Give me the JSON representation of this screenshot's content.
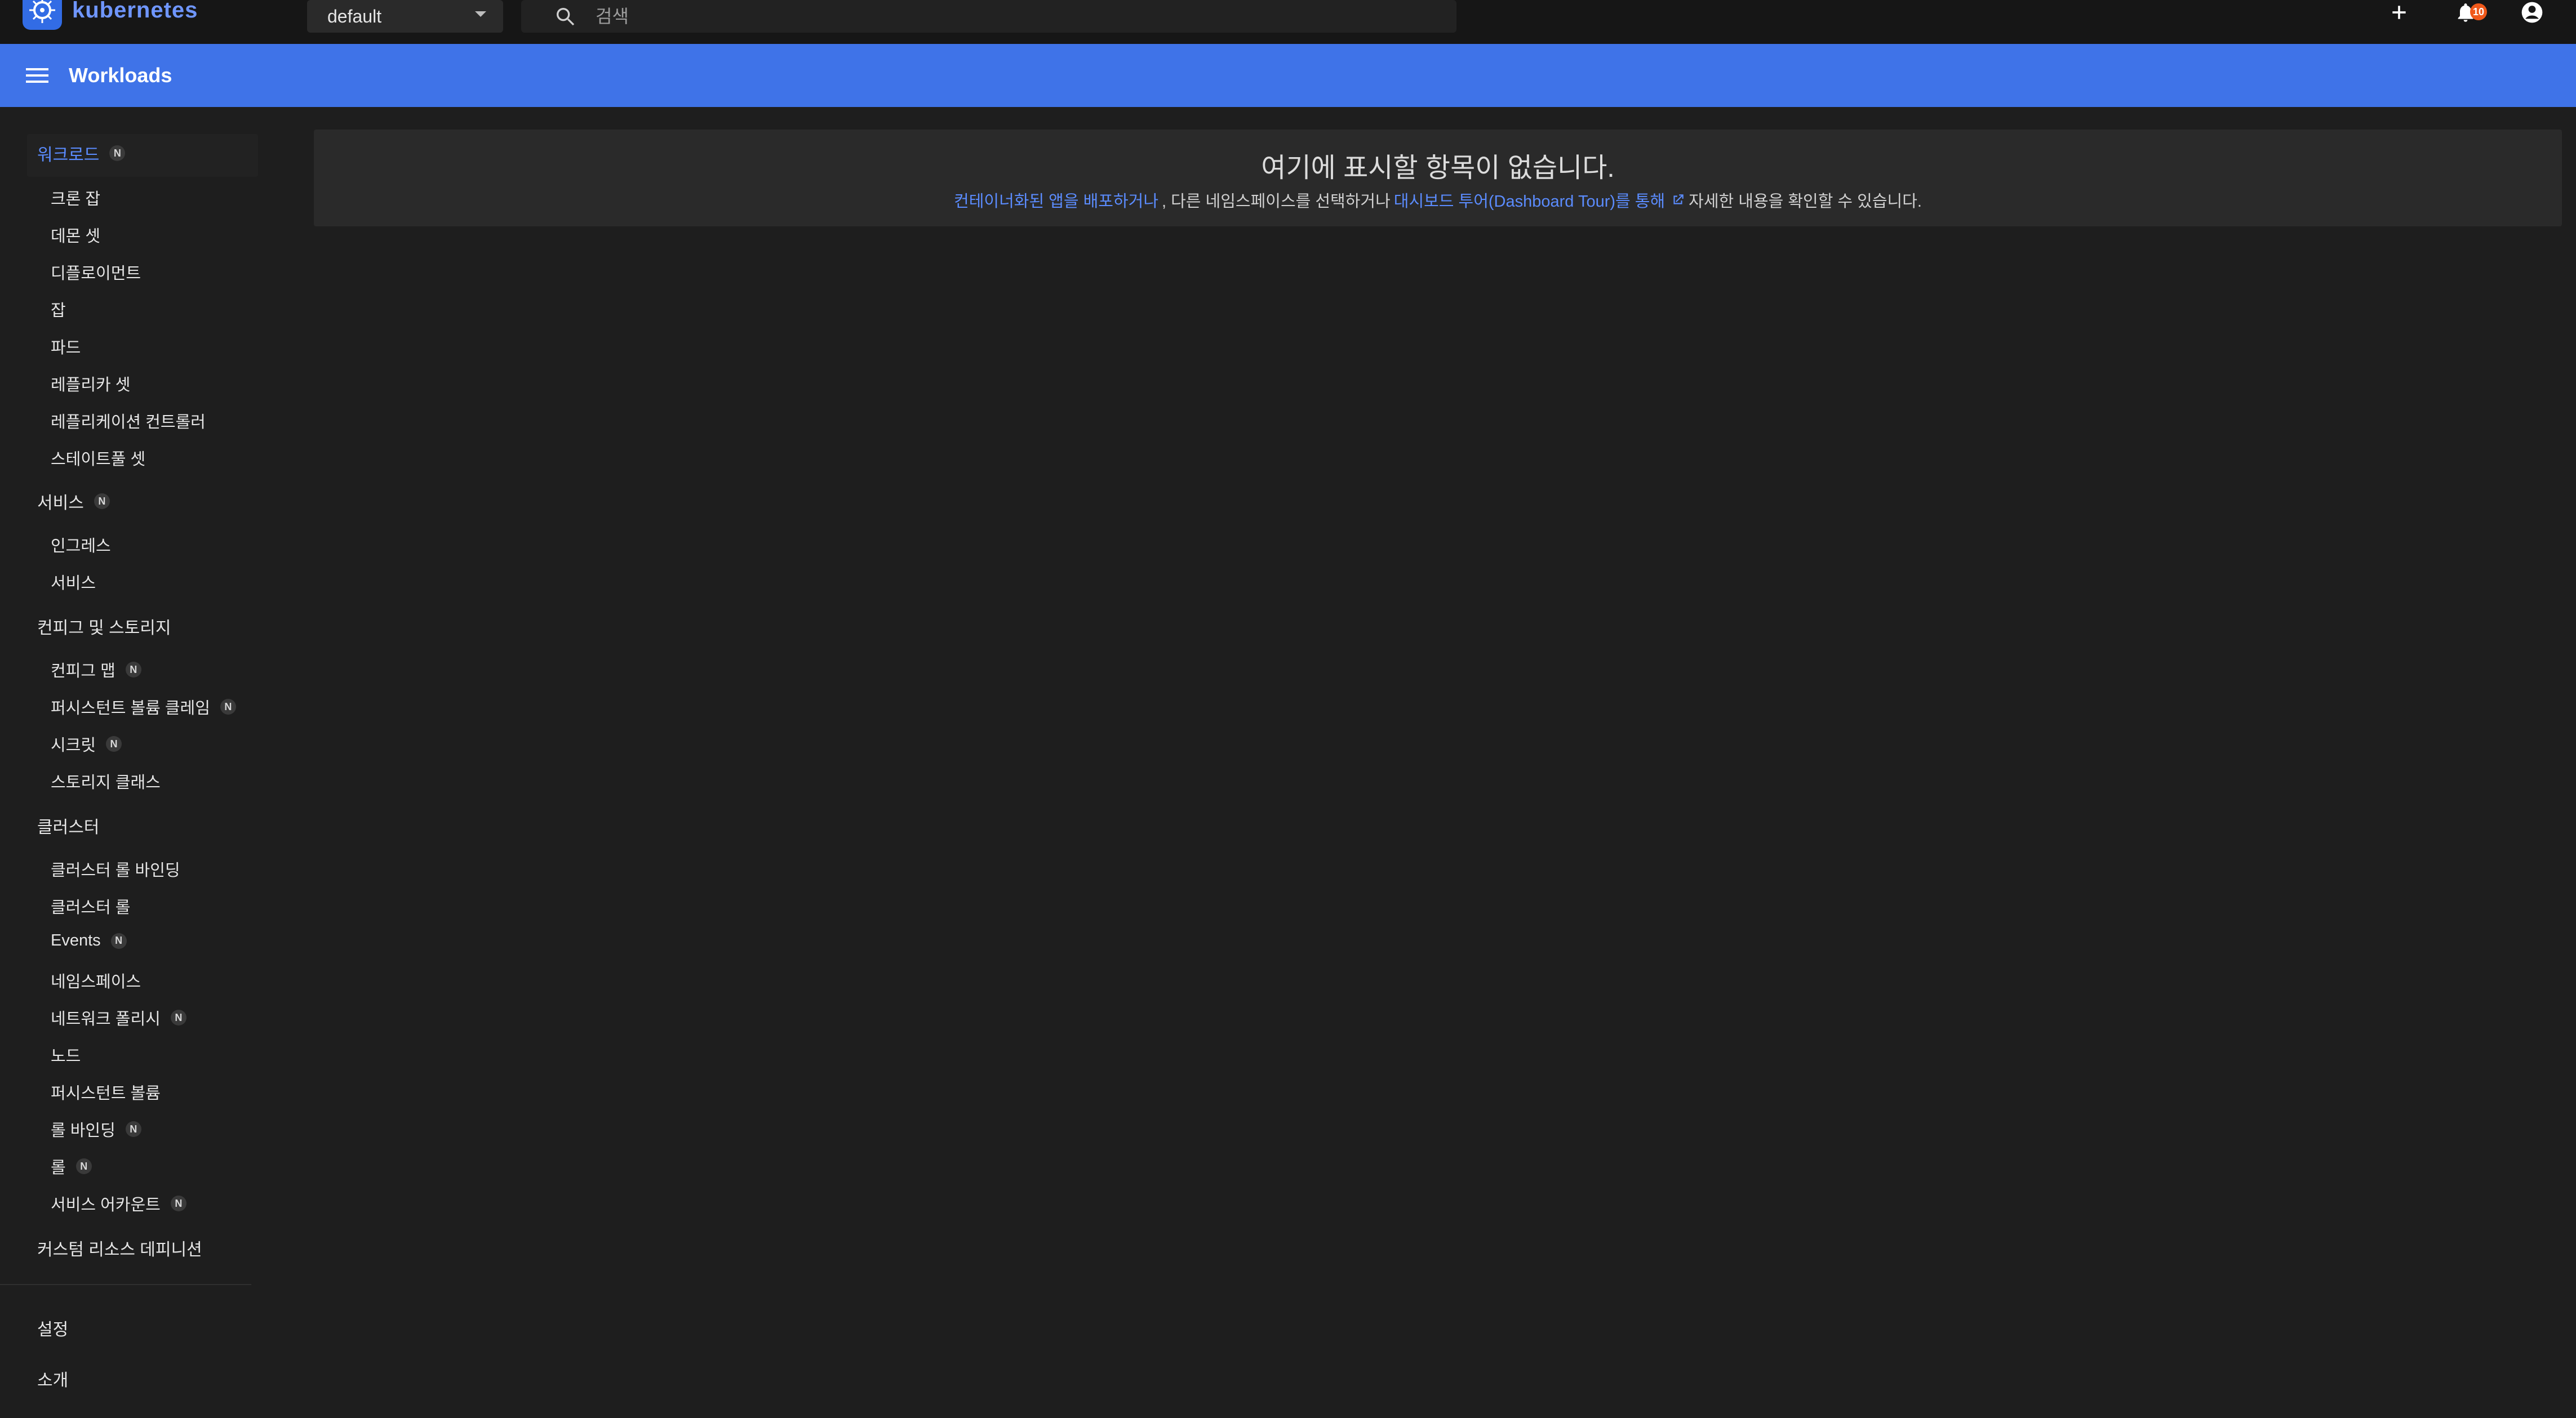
{
  "topbar": {
    "brand": "kubernetes",
    "namespace": "default",
    "search_placeholder": "검색",
    "notifications_count": "10"
  },
  "header": {
    "title": "Workloads"
  },
  "sidebar": {
    "workloads": {
      "label": "워크로드",
      "badge": "N",
      "items": [
        "크론 잡",
        "데몬 셋",
        "디플로이먼트",
        "잡",
        "파드",
        "레플리카 셋",
        "레플리케이션 컨트롤러",
        "스테이트풀 셋"
      ]
    },
    "service": {
      "label": "서비스",
      "badge": "N",
      "items": [
        "인그레스",
        "서비스"
      ]
    },
    "config": {
      "label": "컨피그 및 스토리지",
      "items": [
        {
          "label": "컨피그 맵",
          "badge": "N"
        },
        {
          "label": "퍼시스턴트 볼륨 클레임",
          "badge": "N"
        },
        {
          "label": "시크릿",
          "badge": "N"
        },
        {
          "label": "스토리지 클래스",
          "badge": ""
        }
      ]
    },
    "cluster": {
      "label": "클러스터",
      "items": [
        {
          "label": "클러스터 롤 바인딩",
          "badge": ""
        },
        {
          "label": "클러스터 롤",
          "badge": ""
        },
        {
          "label": "Events",
          "badge": "N"
        },
        {
          "label": "네임스페이스",
          "badge": ""
        },
        {
          "label": "네트워크 폴리시",
          "badge": "N"
        },
        {
          "label": "노드",
          "badge": ""
        },
        {
          "label": "퍼시스턴트 볼륨",
          "badge": ""
        },
        {
          "label": "롤 바인딩",
          "badge": "N"
        },
        {
          "label": "롤",
          "badge": "N"
        },
        {
          "label": "서비스 어카운트",
          "badge": "N"
        }
      ]
    },
    "crd": {
      "label": "커스텀 리소스 데피니션"
    },
    "settings": {
      "label": "설정"
    },
    "about": {
      "label": "소개"
    }
  },
  "empty_state": {
    "title": "여기에 표시할 항목이 없습니다.",
    "link_deploy": "컨테이너화된 앱을 배포하거나",
    "text_middle": ", 다른 네임스페이스를 선택하거나",
    "link_tour": "대시보드 투어(Dashboard Tour)를 통해",
    "text_end": "자세한 내용을 확인할 수 있습니다."
  },
  "colors": {
    "accent": "#3f73e8",
    "link": "#5b8cff",
    "badge": "#f0591b"
  }
}
